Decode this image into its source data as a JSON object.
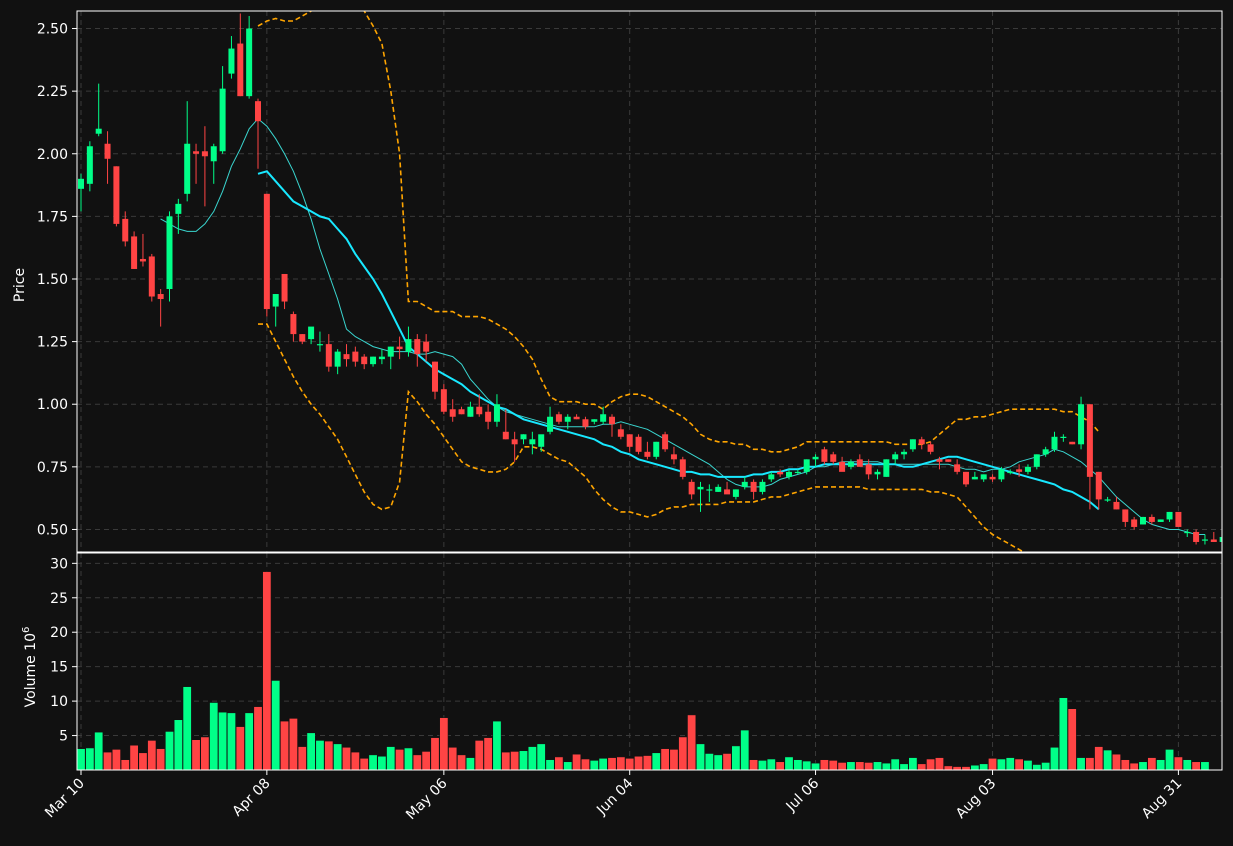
{
  "chart_data": {
    "type": "candlestick",
    "colors": {
      "background": "#111111",
      "up": "#00ff88",
      "down": "#ff4444",
      "grid": "#3a3a3a",
      "ma_fast": "#3ad6d0",
      "ma_slow": "#18e8ff",
      "bands": "#ffa500"
    },
    "price_panel": {
      "ylabel": "Price",
      "ylim": [
        0.41,
        2.57
      ],
      "yticks": [
        "0.50",
        "0.75",
        "1.00",
        "1.25",
        "1.50",
        "1.75",
        "2.00",
        "2.25",
        "2.50"
      ]
    },
    "volume_panel": {
      "ylabel": "Volume  10",
      "ylabel_exponent": "6",
      "ylim": [
        0,
        31.5
      ],
      "yticks": [
        "5",
        "10",
        "15",
        "20",
        "25",
        "30"
      ]
    },
    "xaxis": {
      "tick_labels": [
        "Mar 10",
        "Apr 08",
        "May 06",
        "Jun 04",
        "Jul 06",
        "Aug 03",
        "Aug 31"
      ],
      "tick_index": [
        0,
        21,
        41,
        62,
        83,
        103,
        124
      ]
    },
    "ohlc": [
      [
        1.86,
        1.92,
        1.77,
        1.9
      ],
      [
        1.88,
        2.05,
        1.85,
        2.03
      ],
      [
        2.08,
        2.28,
        2.07,
        2.1
      ],
      [
        2.04,
        2.09,
        1.88,
        1.98
      ],
      [
        1.95,
        1.95,
        1.71,
        1.72
      ],
      [
        1.74,
        1.77,
        1.63,
        1.65
      ],
      [
        1.67,
        1.69,
        1.54,
        1.54
      ],
      [
        1.58,
        1.68,
        1.55,
        1.57
      ],
      [
        1.59,
        1.6,
        1.41,
        1.43
      ],
      [
        1.44,
        1.46,
        1.31,
        1.42
      ],
      [
        1.46,
        1.77,
        1.41,
        1.75
      ],
      [
        1.76,
        1.82,
        1.68,
        1.8
      ],
      [
        1.84,
        2.21,
        1.81,
        2.04
      ],
      [
        2.01,
        2.04,
        1.88,
        2.0
      ],
      [
        2.01,
        2.11,
        1.79,
        1.99
      ],
      [
        1.97,
        2.04,
        1.88,
        2.03
      ],
      [
        2.01,
        2.35,
        2.0,
        2.26
      ],
      [
        2.32,
        2.47,
        2.3,
        2.42
      ],
      [
        2.44,
        2.56,
        2.23,
        2.23
      ],
      [
        2.23,
        2.55,
        2.22,
        2.5
      ],
      [
        2.21,
        2.22,
        1.94,
        2.13
      ],
      [
        1.84,
        1.84,
        1.35,
        1.38
      ],
      [
        1.39,
        1.44,
        1.31,
        1.44
      ],
      [
        1.52,
        1.52,
        1.38,
        1.41
      ],
      [
        1.36,
        1.37,
        1.25,
        1.28
      ],
      [
        1.28,
        1.28,
        1.24,
        1.25
      ],
      [
        1.26,
        1.3,
        1.24,
        1.31
      ],
      [
        1.24,
        1.29,
        1.21,
        1.24
      ],
      [
        1.24,
        1.28,
        1.13,
        1.15
      ],
      [
        1.15,
        1.22,
        1.12,
        1.21
      ],
      [
        1.2,
        1.24,
        1.15,
        1.18
      ],
      [
        1.21,
        1.23,
        1.15,
        1.17
      ],
      [
        1.19,
        1.2,
        1.14,
        1.16
      ],
      [
        1.16,
        1.19,
        1.15,
        1.19
      ],
      [
        1.18,
        1.22,
        1.16,
        1.19
      ],
      [
        1.19,
        1.23,
        1.14,
        1.23
      ],
      [
        1.23,
        1.27,
        1.18,
        1.22
      ],
      [
        1.21,
        1.31,
        1.19,
        1.26
      ],
      [
        1.26,
        1.28,
        1.15,
        1.2
      ],
      [
        1.25,
        1.28,
        1.17,
        1.21
      ],
      [
        1.17,
        1.17,
        1.02,
        1.05
      ],
      [
        1.06,
        1.08,
        0.96,
        0.97
      ],
      [
        0.98,
        1.02,
        0.93,
        0.95
      ],
      [
        0.98,
        0.99,
        0.96,
        0.96
      ],
      [
        0.95,
        1.01,
        0.95,
        0.99
      ],
      [
        0.99,
        1.04,
        0.95,
        0.96
      ],
      [
        0.97,
        1.0,
        0.9,
        0.93
      ],
      [
        0.93,
        1.04,
        0.91,
        1.0
      ],
      [
        0.89,
        0.98,
        0.86,
        0.86
      ],
      [
        0.86,
        0.89,
        0.77,
        0.84
      ],
      [
        0.86,
        0.88,
        0.84,
        0.88
      ],
      [
        0.84,
        0.89,
        0.8,
        0.86
      ],
      [
        0.83,
        0.87,
        0.81,
        0.88
      ],
      [
        0.89,
        0.99,
        0.88,
        0.95
      ],
      [
        0.96,
        0.97,
        0.92,
        0.93
      ],
      [
        0.93,
        0.96,
        0.9,
        0.95
      ],
      [
        0.95,
        0.96,
        0.94,
        0.94
      ],
      [
        0.94,
        0.95,
        0.9,
        0.91
      ],
      [
        0.93,
        0.94,
        0.92,
        0.94
      ],
      [
        0.93,
        0.99,
        0.92,
        0.96
      ],
      [
        0.95,
        0.96,
        0.87,
        0.92
      ],
      [
        0.9,
        0.92,
        0.86,
        0.87
      ],
      [
        0.88,
        0.88,
        0.81,
        0.83
      ],
      [
        0.87,
        0.88,
        0.8,
        0.81
      ],
      [
        0.81,
        0.85,
        0.78,
        0.79
      ],
      [
        0.79,
        0.85,
        0.78,
        0.85
      ],
      [
        0.88,
        0.89,
        0.81,
        0.82
      ],
      [
        0.8,
        0.83,
        0.76,
        0.78
      ],
      [
        0.78,
        0.79,
        0.7,
        0.71
      ],
      [
        0.69,
        0.7,
        0.62,
        0.64
      ],
      [
        0.66,
        0.69,
        0.57,
        0.67
      ],
      [
        0.66,
        0.68,
        0.61,
        0.66
      ],
      [
        0.65,
        0.68,
        0.65,
        0.67
      ],
      [
        0.66,
        0.69,
        0.65,
        0.64
      ],
      [
        0.63,
        0.66,
        0.62,
        0.66
      ],
      [
        0.67,
        0.71,
        0.66,
        0.69
      ],
      [
        0.69,
        0.7,
        0.62,
        0.65
      ],
      [
        0.65,
        0.7,
        0.64,
        0.69
      ],
      [
        0.7,
        0.73,
        0.69,
        0.72
      ],
      [
        0.73,
        0.74,
        0.71,
        0.72
      ],
      [
        0.71,
        0.74,
        0.7,
        0.73
      ],
      [
        0.73,
        0.74,
        0.72,
        0.73
      ],
      [
        0.73,
        0.78,
        0.72,
        0.78
      ],
      [
        0.78,
        0.8,
        0.75,
        0.79
      ],
      [
        0.82,
        0.83,
        0.76,
        0.77
      ],
      [
        0.8,
        0.81,
        0.76,
        0.77
      ],
      [
        0.77,
        0.79,
        0.74,
        0.73
      ],
      [
        0.75,
        0.78,
        0.74,
        0.77
      ],
      [
        0.78,
        0.8,
        0.76,
        0.75
      ],
      [
        0.76,
        0.78,
        0.7,
        0.72
      ],
      [
        0.72,
        0.74,
        0.7,
        0.73
      ],
      [
        0.71,
        0.78,
        0.71,
        0.78
      ],
      [
        0.78,
        0.81,
        0.76,
        0.8
      ],
      [
        0.8,
        0.82,
        0.78,
        0.81
      ],
      [
        0.82,
        0.86,
        0.81,
        0.86
      ],
      [
        0.86,
        0.87,
        0.82,
        0.84
      ],
      [
        0.84,
        0.85,
        0.8,
        0.81
      ],
      [
        0.78,
        0.79,
        0.74,
        0.77
      ],
      [
        0.78,
        0.78,
        0.77,
        0.77
      ],
      [
        0.76,
        0.78,
        0.72,
        0.73
      ],
      [
        0.73,
        0.73,
        0.67,
        0.68
      ],
      [
        0.7,
        0.73,
        0.7,
        0.71
      ],
      [
        0.7,
        0.72,
        0.69,
        0.72
      ],
      [
        0.71,
        0.72,
        0.69,
        0.7
      ],
      [
        0.7,
        0.75,
        0.69,
        0.74
      ],
      [
        0.73,
        0.74,
        0.72,
        0.73
      ],
      [
        0.74,
        0.76,
        0.71,
        0.73
      ],
      [
        0.73,
        0.76,
        0.72,
        0.75
      ],
      [
        0.75,
        0.8,
        0.74,
        0.8
      ],
      [
        0.8,
        0.83,
        0.79,
        0.82
      ],
      [
        0.82,
        0.89,
        0.81,
        0.87
      ],
      [
        0.87,
        0.88,
        0.85,
        0.87
      ],
      [
        0.85,
        0.85,
        0.84,
        0.84
      ],
      [
        0.84,
        1.03,
        0.82,
        1.0
      ],
      [
        1.0,
        1.0,
        0.58,
        0.71
      ],
      [
        0.73,
        0.73,
        0.58,
        0.62
      ],
      [
        0.62,
        0.63,
        0.61,
        0.62
      ],
      [
        0.61,
        0.63,
        0.58,
        0.58
      ],
      [
        0.58,
        0.58,
        0.51,
        0.53
      ],
      [
        0.54,
        0.55,
        0.5,
        0.51
      ],
      [
        0.52,
        0.55,
        0.52,
        0.55
      ],
      [
        0.55,
        0.56,
        0.52,
        0.53
      ],
      [
        0.53,
        0.54,
        0.53,
        0.54
      ],
      [
        0.54,
        0.57,
        0.53,
        0.57
      ],
      [
        0.57,
        0.57,
        0.51,
        0.51
      ],
      [
        0.49,
        0.5,
        0.47,
        0.49
      ],
      [
        0.49,
        0.5,
        0.44,
        0.45
      ],
      [
        0.46,
        0.48,
        0.44,
        0.46
      ],
      [
        0.46,
        0.49,
        0.45,
        0.45
      ],
      [
        0.45,
        0.48,
        0.44,
        0.47
      ],
      [
        0.47,
        0.47,
        0.44,
        0.44
      ]
    ],
    "volume": [
      3.1,
      3.2,
      5.5,
      2.6,
      3.0,
      1.5,
      3.6,
      2.5,
      4.3,
      3.1,
      5.6,
      7.3,
      12.1,
      4.4,
      4.8,
      9.8,
      8.4,
      8.3,
      6.3,
      8.3,
      9.2,
      28.8,
      13.0,
      7.1,
      7.5,
      3.4,
      5.4,
      4.3,
      4.2,
      3.8,
      3.3,
      2.6,
      1.7,
      2.2,
      2.0,
      3.4,
      3.0,
      3.2,
      2.2,
      2.7,
      4.7,
      7.6,
      3.3,
      2.2,
      1.8,
      4.3,
      4.7,
      7.1,
      2.6,
      2.7,
      2.8,
      3.4,
      3.8,
      1.5,
      1.9,
      1.2,
      2.3,
      1.6,
      1.4,
      1.7,
      1.8,
      1.9,
      1.7,
      2.0,
      2.1,
      2.5,
      3.1,
      3.0,
      4.8,
      8.0,
      3.8,
      2.4,
      2.2,
      2.4,
      3.5,
      5.8,
      1.5,
      1.4,
      1.6,
      1.2,
      1.9,
      1.5,
      1.3,
      1.0,
      1.5,
      1.4,
      1.1,
      1.2,
      1.2,
      1.1,
      1.2,
      1.0,
      1.6,
      0.9,
      1.8,
      0.9,
      1.6,
      1.8,
      0.6,
      0.5,
      0.5,
      0.7,
      0.9,
      1.7,
      1.6,
      1.8,
      1.6,
      1.4,
      0.8,
      1.1,
      3.3,
      10.5,
      8.9,
      1.8,
      1.8,
      3.4,
      2.9,
      2.3,
      1.5,
      1.0,
      1.2,
      1.8,
      1.5,
      3.0,
      1.9,
      1.5,
      1.2,
      1.2
    ],
    "ma_fast": {
      "start": 9,
      "values": [
        1.74,
        1.72,
        1.7,
        1.69,
        1.69,
        1.72,
        1.77,
        1.85,
        1.95,
        2.02,
        2.1,
        2.14,
        2.11,
        2.06,
        2.0,
        1.93,
        1.84,
        1.74,
        1.62,
        1.52,
        1.42,
        1.3,
        1.27,
        1.25,
        1.23,
        1.22,
        1.21,
        1.21,
        1.21,
        1.2,
        1.2,
        1.21,
        1.2,
        1.19,
        1.16,
        1.1,
        1.06,
        1.02,
        0.99,
        0.97,
        0.96,
        0.95,
        0.94,
        0.93,
        0.92,
        0.91,
        0.91,
        0.91,
        0.91,
        0.91,
        0.92,
        0.92,
        0.93,
        0.92,
        0.91,
        0.9,
        0.88,
        0.86,
        0.84,
        0.82,
        0.8,
        0.78,
        0.76,
        0.73,
        0.7,
        0.68,
        0.67,
        0.67,
        0.67,
        0.68,
        0.7,
        0.71,
        0.72,
        0.73,
        0.75,
        0.75,
        0.76,
        0.77,
        0.77,
        0.77,
        0.77,
        0.77,
        0.76,
        0.76,
        0.76,
        0.76,
        0.76,
        0.76,
        0.76,
        0.76,
        0.75,
        0.74,
        0.74,
        0.73,
        0.74,
        0.74,
        0.75,
        0.77,
        0.78,
        0.79,
        0.8,
        0.82,
        0.81,
        0.79,
        0.77,
        0.74,
        0.71,
        0.67,
        0.63,
        0.6,
        0.57,
        0.54,
        0.52,
        0.51,
        0.5,
        0.5,
        0.49,
        0.48,
        0.48
      ]
    },
    "ma_slow": {
      "start": 20,
      "values": [
        1.92,
        1.93,
        1.89,
        1.85,
        1.81,
        1.79,
        1.77,
        1.75,
        1.74,
        1.7,
        1.66,
        1.6,
        1.55,
        1.5,
        1.44,
        1.37,
        1.3,
        1.23,
        1.2,
        1.17,
        1.14,
        1.12,
        1.1,
        1.08,
        1.05,
        1.03,
        1.01,
        0.99,
        0.98,
        0.96,
        0.94,
        0.93,
        0.92,
        0.91,
        0.9,
        0.89,
        0.88,
        0.87,
        0.86,
        0.84,
        0.83,
        0.81,
        0.8,
        0.78,
        0.77,
        0.76,
        0.75,
        0.74,
        0.73,
        0.73,
        0.72,
        0.72,
        0.71,
        0.71,
        0.71,
        0.71,
        0.72,
        0.72,
        0.73,
        0.73,
        0.74,
        0.74,
        0.75,
        0.75,
        0.76,
        0.76,
        0.76,
        0.76,
        0.76,
        0.76,
        0.76,
        0.76,
        0.76,
        0.75,
        0.75,
        0.76,
        0.77,
        0.78,
        0.79,
        0.79,
        0.78,
        0.77,
        0.76,
        0.75,
        0.74,
        0.73,
        0.72,
        0.71,
        0.7,
        0.69,
        0.68,
        0.66,
        0.65,
        0.63,
        0.61,
        0.58
      ]
    },
    "band_upper": {
      "start": 20,
      "values": [
        2.51,
        2.53,
        2.54,
        2.53,
        2.53,
        2.55,
        2.57,
        2.58,
        2.59,
        2.6,
        2.6,
        2.6,
        2.57,
        2.51,
        2.44,
        2.25,
        2.0,
        1.41,
        1.41,
        1.39,
        1.37,
        1.37,
        1.37,
        1.35,
        1.35,
        1.35,
        1.34,
        1.32,
        1.3,
        1.27,
        1.23,
        1.18,
        1.1,
        1.03,
        1.01,
        1.01,
        1.01,
        1.0,
        1.0,
        0.98,
        1.01,
        1.03,
        1.04,
        1.04,
        1.03,
        1.01,
        0.99,
        0.97,
        0.95,
        0.92,
        0.88,
        0.86,
        0.85,
        0.85,
        0.84,
        0.84,
        0.82,
        0.82,
        0.81,
        0.81,
        0.82,
        0.83,
        0.85,
        0.85,
        0.85,
        0.85,
        0.85,
        0.85,
        0.85,
        0.85,
        0.85,
        0.85,
        0.84,
        0.84,
        0.84,
        0.84,
        0.85,
        0.88,
        0.91,
        0.94,
        0.94,
        0.95,
        0.95,
        0.96,
        0.97,
        0.98,
        0.98,
        0.98,
        0.98,
        0.98,
        0.98,
        0.97,
        0.97,
        0.95,
        0.93,
        0.89
      ]
    },
    "band_lower": {
      "start": 20,
      "values": [
        1.32,
        1.32,
        1.25,
        1.18,
        1.11,
        1.05,
        1.0,
        0.96,
        0.91,
        0.86,
        0.79,
        0.72,
        0.65,
        0.6,
        0.58,
        0.59,
        0.69,
        1.05,
        1.01,
        0.96,
        0.92,
        0.87,
        0.82,
        0.77,
        0.75,
        0.74,
        0.73,
        0.73,
        0.74,
        0.77,
        0.83,
        0.83,
        0.82,
        0.8,
        0.78,
        0.77,
        0.74,
        0.71,
        0.66,
        0.62,
        0.59,
        0.57,
        0.57,
        0.56,
        0.55,
        0.56,
        0.58,
        0.59,
        0.59,
        0.6,
        0.6,
        0.6,
        0.6,
        0.61,
        0.61,
        0.61,
        0.61,
        0.62,
        0.63,
        0.63,
        0.64,
        0.65,
        0.66,
        0.67,
        0.67,
        0.67,
        0.67,
        0.67,
        0.67,
        0.66,
        0.66,
        0.66,
        0.66,
        0.66,
        0.66,
        0.66,
        0.65,
        0.65,
        0.64,
        0.63,
        0.59,
        0.55,
        0.51,
        0.48,
        0.46,
        0.44,
        0.42,
        0.4,
        0.38,
        0.36,
        0.34,
        0.32,
        0.3,
        0.28,
        0.26,
        0.24
      ]
    }
  }
}
